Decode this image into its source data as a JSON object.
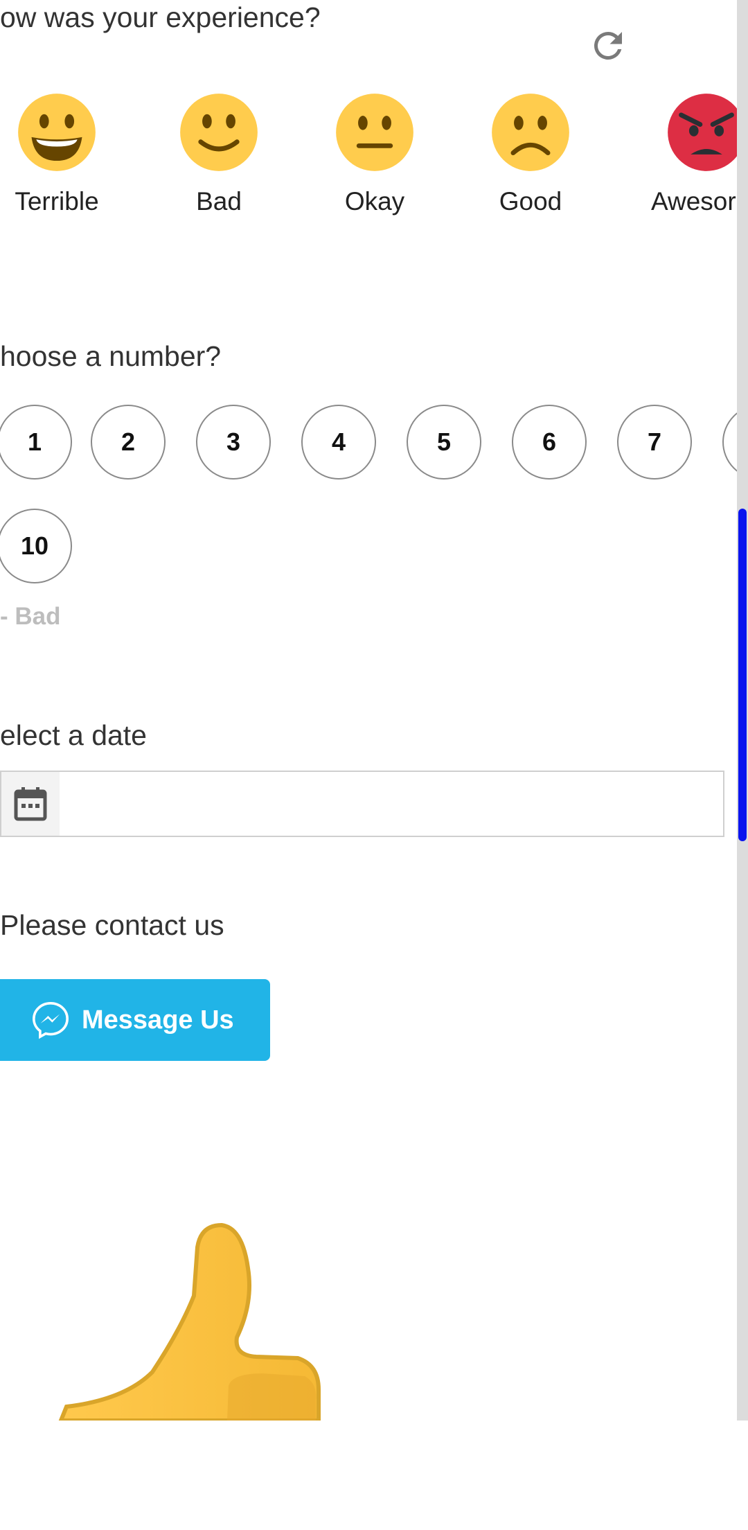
{
  "experience": {
    "question": "ow was your experience?",
    "options": [
      {
        "label": "Terrible",
        "icon": "grinning-face-icon"
      },
      {
        "label": "Bad",
        "icon": "smiling-face-icon"
      },
      {
        "label": "Okay",
        "icon": "neutral-face-icon"
      },
      {
        "label": "Good",
        "icon": "frowning-face-icon"
      },
      {
        "label": "Awesor",
        "icon": "angry-face-icon"
      }
    ],
    "refresh_icon": "refresh-icon"
  },
  "number": {
    "question": "hoose a number?",
    "options": [
      "1",
      "2",
      "3",
      "4",
      "5",
      "6",
      "7",
      "10"
    ],
    "hint": "- Bad"
  },
  "date": {
    "question": "elect a date",
    "value": "",
    "icon": "calendar-icon"
  },
  "contact": {
    "question": "Please contact us",
    "button_label": "Message Us",
    "icon": "messenger-icon",
    "button_color": "#21b4e7"
  },
  "footer": {
    "image": "thumbs-up-image"
  },
  "scroll": {
    "position_fraction": 0.36,
    "thumb_color": "#0a13ee"
  }
}
